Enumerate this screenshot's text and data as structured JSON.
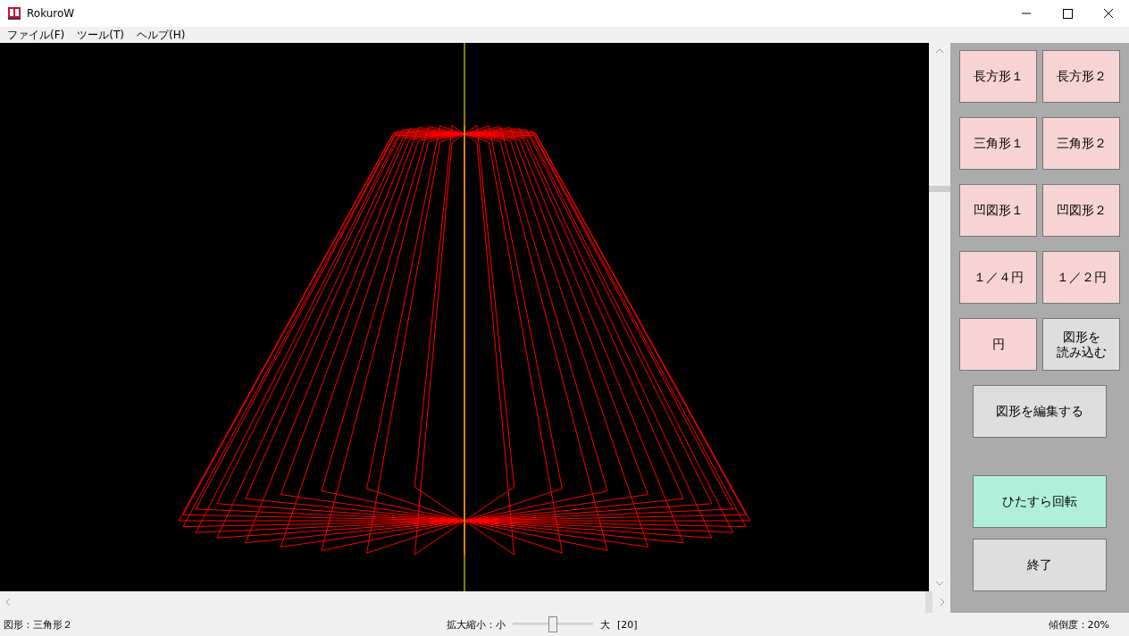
{
  "window": {
    "title": "RokuroW"
  },
  "menu": [
    {
      "label": "ファイル(F)"
    },
    {
      "label": "ツール(T)"
    },
    {
      "label": "ヘルプ(H)"
    }
  ],
  "grid_buttons": [
    {
      "lines": [
        "長方形１"
      ],
      "kind": "shape"
    },
    {
      "lines": [
        "長方形２"
      ],
      "kind": "shape"
    },
    {
      "lines": [
        "三角形１"
      ],
      "kind": "shape"
    },
    {
      "lines": [
        "三角形２"
      ],
      "kind": "shape"
    },
    {
      "lines": [
        "凹図形１"
      ],
      "kind": "shape"
    },
    {
      "lines": [
        "凹図形２"
      ],
      "kind": "shape"
    },
    {
      "lines": [
        "１／４円"
      ],
      "kind": "shape"
    },
    {
      "lines": [
        "１／２円"
      ],
      "kind": "shape"
    },
    {
      "lines": [
        "円"
      ],
      "kind": "shape"
    },
    {
      "lines": [
        "図形を",
        "読み込む"
      ],
      "kind": "action"
    }
  ],
  "command_buttons": [
    {
      "label": "図形を編集する",
      "kind": "action"
    },
    {
      "label": "ひたすら回転",
      "kind": "run"
    },
    {
      "label": "終了",
      "kind": "action"
    }
  ],
  "status_bar": {
    "shape": "図形：三角形２",
    "zoom_label": "拡大縮小：小",
    "zoom": {
      "level": 0.5
    },
    "zoom_max_label": "大",
    "zoom_value": "[20]",
    "tilt": "傾倒度：20%"
  }
}
